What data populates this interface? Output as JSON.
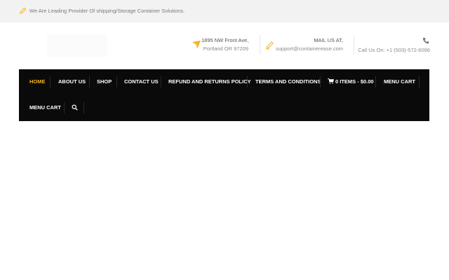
{
  "topbar": {
    "tagline": "We Are Leading Provider Of shipping/Storage Container Solutions."
  },
  "header": {
    "address_line1": "1895 NW Front Ave,",
    "address_line2": "Portland OR 97209",
    "mail_label": "MAIL US AT,",
    "mail_value": "support@containerease.com",
    "phone_text": "Call Us On: +1 (503)-572-6096"
  },
  "nav": {
    "items": [
      {
        "label": "HOME",
        "active": true
      },
      {
        "label": "ABOUT US"
      },
      {
        "label": "SHOP"
      },
      {
        "label": "CONTACT US"
      },
      {
        "label": "REFUND AND RETURNS POLICY"
      },
      {
        "label": "TERMS AND CONDITIONS"
      },
      {
        "label": "0 ITEMS - $0.00"
      },
      {
        "label": "MENU CART"
      },
      {
        "label": "MENU CART"
      }
    ]
  },
  "colors": {
    "accent": "#f5b522",
    "nav_bg": "#0a0a0a",
    "topbar_bg": "#f2f2f2"
  },
  "icons": [
    "pencil-icon",
    "location-arrow-icon",
    "edit-icon",
    "phone-icon",
    "cart-icon",
    "search-icon"
  ]
}
